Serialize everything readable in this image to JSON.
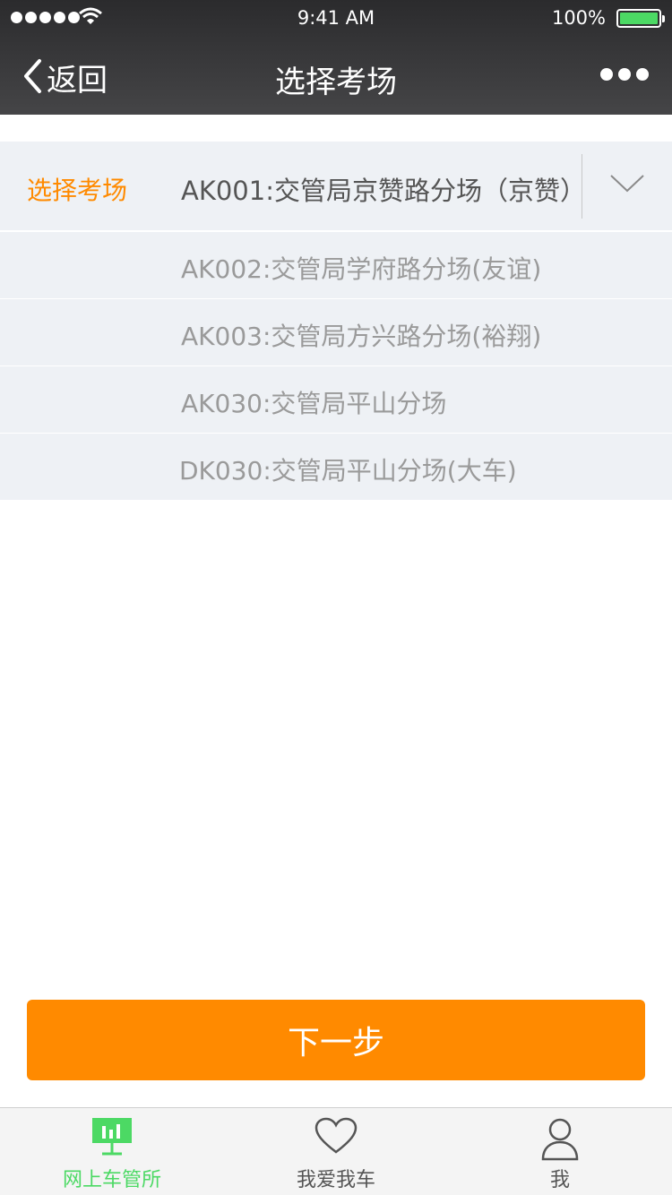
{
  "status_bar": {
    "time": "9:41 AM",
    "battery": "100%"
  },
  "nav": {
    "back_label": "返回",
    "title": "选择考场",
    "more_icon": "ellipsis-icon"
  },
  "selector": {
    "label": "选择考场",
    "selected": "AK001:交管局京赞路分场（京赞）",
    "options": [
      "AK002:交管局学府路分场(友谊)",
      "AK003:交管局方兴路分场(裕翔)",
      "AK030:交管局平山分场",
      "DK030:交管局平山分场(大车)"
    ]
  },
  "next_button": {
    "label": "下一步"
  },
  "tabs": [
    {
      "label": "网上车管所",
      "icon": "office-chart-icon",
      "active": true
    },
    {
      "label": "我爱我车",
      "icon": "heart-icon",
      "active": false
    },
    {
      "label": "我",
      "icon": "person-icon",
      "active": false
    }
  ],
  "colors": {
    "accent": "#ff8a00",
    "tab_active": "#4cd964",
    "header": "#3a3a3c"
  }
}
